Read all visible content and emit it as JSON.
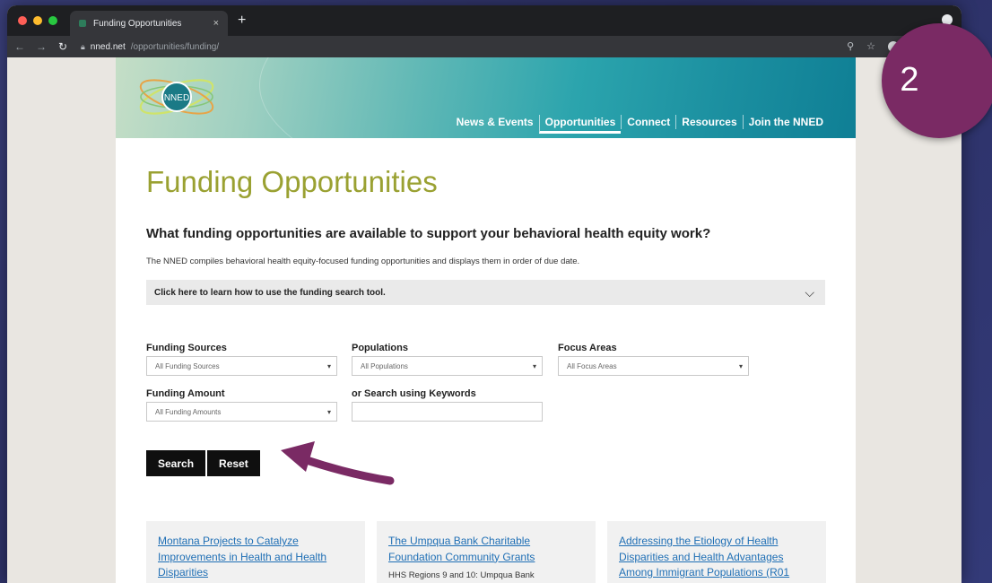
{
  "browser": {
    "tab_title": "Funding Opportunities",
    "tab_close": "×",
    "new_tab": "+",
    "url_host": "nned.net",
    "url_path": "/opportunities/funding/",
    "icons": [
      "back-icon",
      "forward-icon",
      "reload-icon",
      "lock-icon",
      "zoom-icon",
      "star-icon",
      "profile-icon"
    ]
  },
  "site": {
    "logo_text": "NNED",
    "nav": [
      {
        "label": "News & Events",
        "active": false
      },
      {
        "label": "Opportunities",
        "active": true
      },
      {
        "label": "Connect",
        "active": false
      },
      {
        "label": "Resources",
        "active": false
      },
      {
        "label": "Join the NNED",
        "active": false
      }
    ]
  },
  "main": {
    "title": "Funding Opportunities",
    "question": "What funding opportunities are available to support your behavioral health equity work?",
    "intro": "The NNED compiles behavioral health equity-focused funding opportunities and displays them in order of due date.",
    "accordion_label": "Click here to learn how to use the funding search tool."
  },
  "filters": {
    "funding_sources": {
      "label": "Funding Sources",
      "value": "All Funding Sources"
    },
    "populations": {
      "label": "Populations",
      "value": "All Populations"
    },
    "focus_areas": {
      "label": "Focus Areas",
      "value": "All Focus Areas"
    },
    "funding_amount": {
      "label": "Funding Amount",
      "value": "All Funding Amounts"
    },
    "keywords": {
      "label": "or Search using Keywords",
      "value": ""
    }
  },
  "actions": {
    "search_label": "Search",
    "reset_label": "Reset"
  },
  "cards": [
    {
      "title": "Montana Projects to Catalyze Improvements in Health and Health Disparities",
      "snippet": ""
    },
    {
      "title": "The Umpqua Bank Charitable Foundation Community Grants",
      "snippet": "HHS Regions 9 and 10: Umpqua Bank"
    },
    {
      "title": "Addressing the Etiology of Health Disparities and Health Advantages Among Immigrant Populations (R01",
      "snippet": ""
    }
  ],
  "overlay": {
    "step_number": "2",
    "badge_color": "#7a2a64",
    "arrow_color": "#7a2a64"
  }
}
